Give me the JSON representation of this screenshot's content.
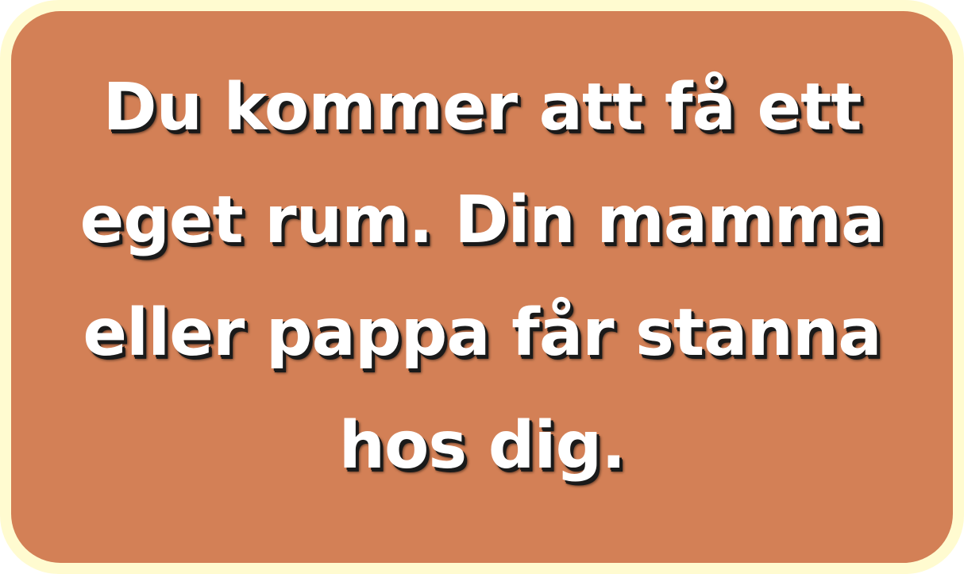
{
  "card": {
    "background_color": "#d38056",
    "border_color": "#fffbd0",
    "text_color": "#ffffff",
    "lines": [
      "Du kommer att få ett",
      "eget rum. Din mamma",
      "eller pappa får stanna",
      "hos dig."
    ]
  }
}
